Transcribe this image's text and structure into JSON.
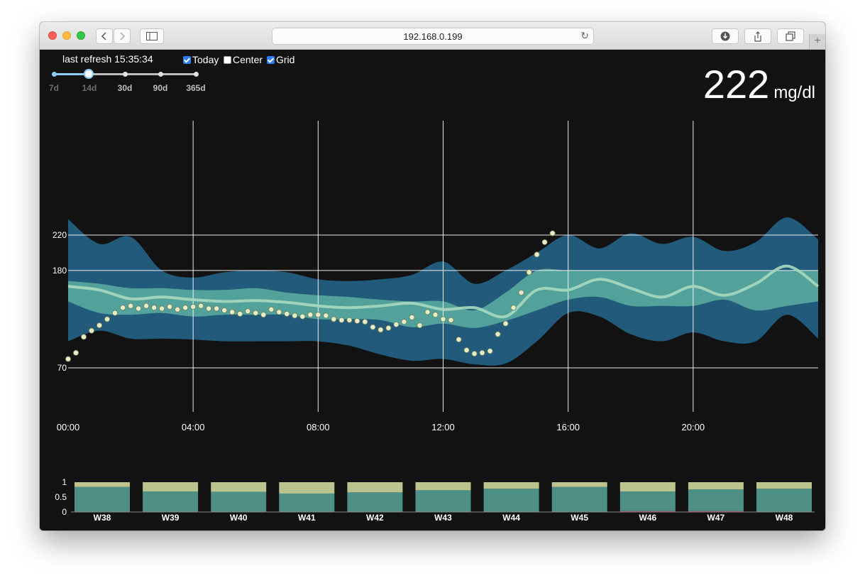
{
  "browser": {
    "url": "192.168.0.199"
  },
  "header": {
    "refresh_label": "last refresh 15:35:34",
    "checkboxes": [
      {
        "label": "Today",
        "checked": true
      },
      {
        "label": "Center",
        "checked": false
      },
      {
        "label": "Grid",
        "checked": true
      }
    ],
    "range_options": [
      "7d",
      "14d",
      "30d",
      "90d",
      "365d"
    ],
    "range_selected": "14d"
  },
  "current": {
    "value": "222",
    "unit": "mg/dl"
  },
  "colors": {
    "background": "#121212",
    "outer_band": "#215a7a",
    "inner_band": "#52a19b",
    "high": "#d4365d",
    "median": "#a8d8bf",
    "today_points": "#e6edc4",
    "bar_high_part": "#bbc48f",
    "bar_range": "#4e9086",
    "bar_low": "#d4365d"
  },
  "chart_data": [
    {
      "type": "area",
      "x_ticks": [
        "00:00",
        "04:00",
        "08:00",
        "12:00",
        "16:00",
        "20:00"
      ],
      "y_ticks": [
        70,
        180,
        220
      ],
      "grid": true,
      "thresholds": {
        "low": 70,
        "high": 180
      },
      "x": [
        0,
        1,
        2,
        3,
        4,
        5,
        6,
        7,
        8,
        9,
        10,
        11,
        12,
        13,
        14,
        15,
        16,
        17,
        18,
        19,
        20,
        21,
        22,
        23,
        24
      ],
      "outer_upper": [
        238,
        210,
        218,
        180,
        172,
        178,
        180,
        178,
        170,
        168,
        170,
        175,
        190,
        165,
        180,
        200,
        220,
        205,
        222,
        210,
        218,
        202,
        212,
        240,
        215
      ],
      "inner_upper": [
        168,
        165,
        160,
        160,
        158,
        158,
        160,
        155,
        152,
        150,
        147,
        145,
        145,
        135,
        155,
        180,
        180,
        180,
        180,
        180,
        180,
        180,
        180,
        180,
        180
      ],
      "median": [
        162,
        158,
        148,
        150,
        147,
        145,
        146,
        144,
        140,
        138,
        140,
        143,
        136,
        138,
        128,
        158,
        158,
        170,
        160,
        150,
        162,
        152,
        165,
        185,
        162
      ],
      "inner_lower": [
        145,
        132,
        130,
        132,
        128,
        130,
        130,
        130,
        125,
        125,
        124,
        116,
        120,
        115,
        123,
        135,
        147,
        150,
        140,
        140,
        140,
        147,
        135,
        140,
        145
      ],
      "outer_lower": [
        100,
        112,
        103,
        103,
        102,
        100,
        100,
        100,
        100,
        95,
        85,
        78,
        80,
        74,
        75,
        100,
        132,
        128,
        108,
        100,
        110,
        100,
        100,
        130,
        103
      ],
      "today_x": [
        0,
        0.25,
        0.5,
        0.75,
        1,
        1.25,
        1.5,
        1.75,
        2,
        2.25,
        2.5,
        2.75,
        3,
        3.25,
        3.5,
        3.75,
        4,
        4.25,
        4.5,
        4.75,
        5,
        5.25,
        5.5,
        5.75,
        6,
        6.25,
        6.5,
        6.75,
        7,
        7.25,
        7.5,
        7.75,
        8,
        8.25,
        8.5,
        8.75,
        9,
        9.25,
        9.5,
        9.75,
        10,
        10.25,
        10.5,
        10.75,
        11,
        11.25,
        11.5,
        11.75,
        12,
        12.25,
        12.5,
        12.75,
        13,
        13.25,
        13.5,
        13.75,
        14,
        14.25,
        14.5,
        14.75,
        15,
        15.25,
        15.5
      ],
      "today_y": [
        80,
        87,
        105,
        112,
        118,
        125,
        132,
        138,
        140,
        137,
        140,
        138,
        137,
        139,
        136,
        138,
        139,
        140,
        137,
        137,
        135,
        133,
        131,
        134,
        132,
        130,
        136,
        133,
        131,
        129,
        128,
        130,
        130,
        129,
        125,
        124,
        124,
        123,
        122,
        116,
        113,
        115,
        119,
        122,
        127,
        118,
        133,
        130,
        125,
        124,
        102,
        90,
        86,
        87,
        89,
        108,
        120,
        138,
        155,
        178,
        198,
        212,
        222
      ]
    },
    {
      "type": "bar",
      "stacked": true,
      "categories": [
        "W38",
        "W39",
        "W40",
        "W41",
        "W42",
        "W43",
        "W44",
        "W45",
        "W46",
        "W47",
        "W48"
      ],
      "y_ticks": [
        "0",
        "0.5",
        "1"
      ],
      "ylim": [
        0,
        1
      ],
      "series": [
        {
          "values": [
            0.01,
            0.0,
            0.01,
            0.0,
            0.01,
            0.0,
            0.0,
            0.01,
            0.03,
            0.03,
            0.0
          ]
        },
        {
          "values": [
            0.83,
            0.69,
            0.67,
            0.62,
            0.65,
            0.73,
            0.78,
            0.83,
            0.66,
            0.73,
            0.78
          ]
        },
        {
          "values": [
            0.16,
            0.31,
            0.32,
            0.38,
            0.34,
            0.27,
            0.22,
            0.16,
            0.31,
            0.24,
            0.22
          ]
        }
      ]
    }
  ]
}
